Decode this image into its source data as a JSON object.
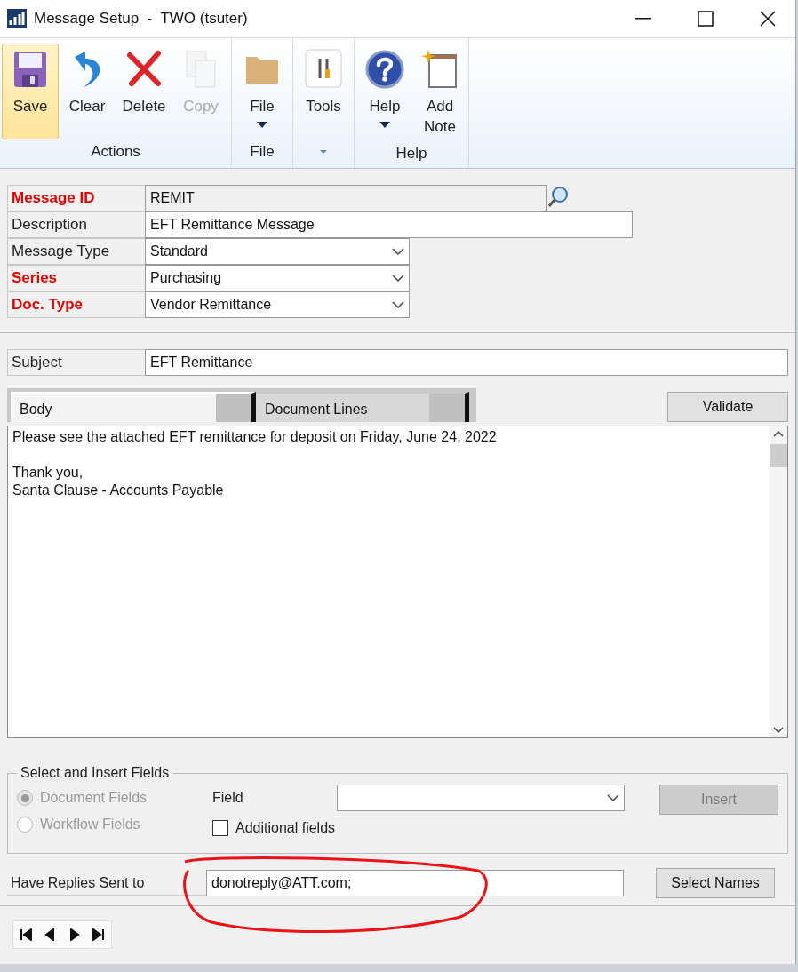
{
  "window": {
    "title": "Message Setup  -  TWO (tsuter)"
  },
  "ribbon": {
    "groups": [
      {
        "label": "Actions",
        "buttons": [
          {
            "label": "Save",
            "kind": "save",
            "selected": true,
            "disabled": false
          },
          {
            "label": "Clear",
            "kind": "undo",
            "selected": false,
            "disabled": false
          },
          {
            "label": "Delete",
            "kind": "delete",
            "selected": false,
            "disabled": false
          },
          {
            "label": "Copy",
            "kind": "copy",
            "selected": false,
            "disabled": true
          }
        ]
      },
      {
        "label": "File",
        "buttons": [
          {
            "label": "File",
            "kind": "folder",
            "selected": false,
            "disabled": false,
            "dropdown": true
          }
        ]
      },
      {
        "buttons": [
          {
            "label": "Tools",
            "kind": "tools",
            "selected": false,
            "disabled": false
          }
        ],
        "group_menu": true
      },
      {
        "label": "Help",
        "buttons": [
          {
            "label": "Help",
            "kind": "help",
            "selected": false,
            "disabled": false,
            "dropdown": true
          },
          {
            "label": "Add Note",
            "kind": "note",
            "selected": false,
            "disabled": false
          }
        ]
      }
    ]
  },
  "fields": [
    {
      "label": "Message ID",
      "required": true,
      "kind": "lookup",
      "value": "REMIT"
    },
    {
      "label": "Description",
      "required": false,
      "kind": "text",
      "value": "EFT Remittance Message"
    },
    {
      "label": "Message Type",
      "required": false,
      "kind": "dropdown",
      "value": "Standard"
    },
    {
      "label": "Series",
      "required": true,
      "kind": "dropdown",
      "value": "Purchasing"
    },
    {
      "label": "Doc. Type",
      "required": true,
      "kind": "dropdown",
      "value": "Vendor Remittance"
    }
  ],
  "subject": {
    "label": "Subject",
    "value": "EFT Remittance"
  },
  "tabs": [
    {
      "label": "Body",
      "selected": true
    },
    {
      "label": "Document Lines",
      "selected": false
    }
  ],
  "validate_button": "Validate",
  "body": {
    "value": "Please see the attached EFT remittance for deposit on Friday, June 24, 2022\n\nThank you,\nSanta Clause - Accounts Payable\n"
  },
  "insert_fields": {
    "title": "Select and Insert Fields",
    "options": [
      {
        "label": "Document Fields",
        "selected": true,
        "disabled": true
      },
      {
        "label": "Workflow Fields",
        "selected": false,
        "disabled": true
      }
    ],
    "field_label": "Field",
    "additional": {
      "label": "Additional fields",
      "checked": false
    },
    "insert_button": {
      "label": "Insert",
      "disabled": true
    }
  },
  "replies": {
    "label": "Have Replies Sent to",
    "value": "donotreply@ATT.com;",
    "button": "Select Names"
  }
}
